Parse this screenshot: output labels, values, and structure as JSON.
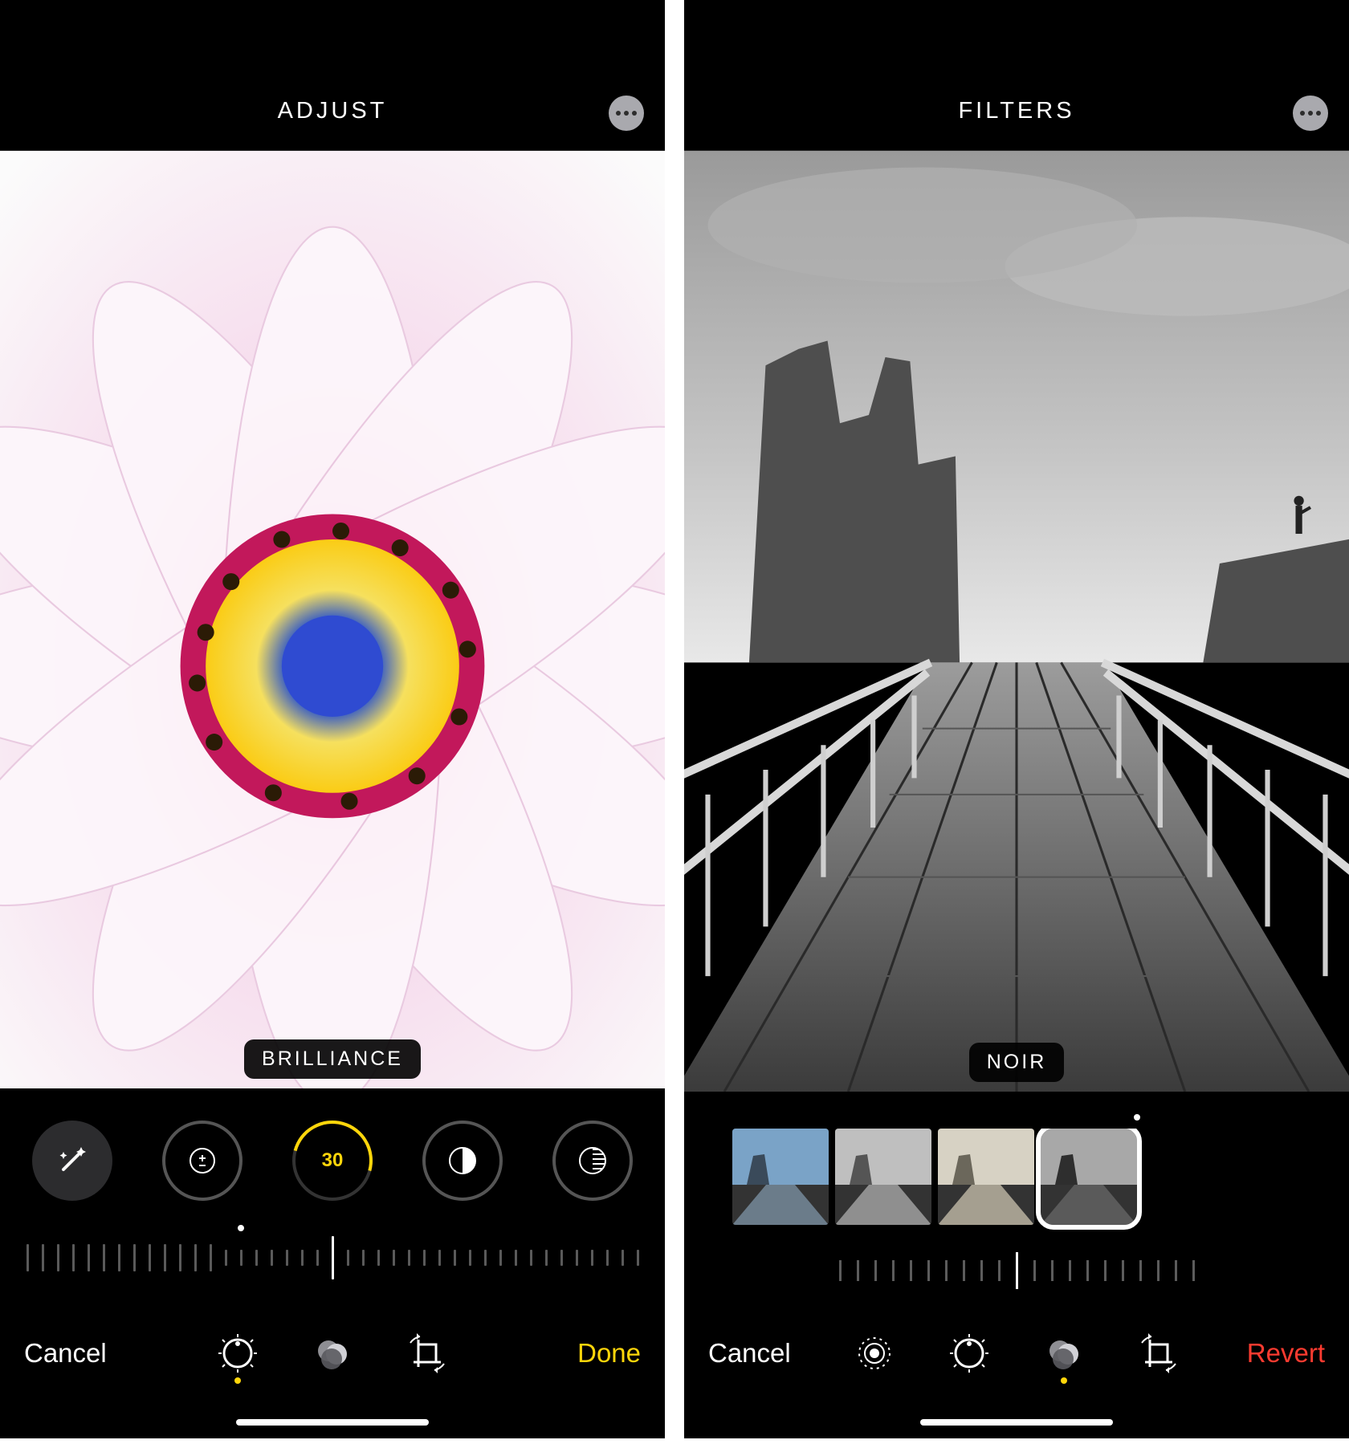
{
  "left": {
    "header": {
      "title": "ADJUST"
    },
    "badge": "BRILLIANCE",
    "adjustment_value": "30",
    "toolbar": {
      "cancel": "Cancel",
      "done": "Done"
    },
    "dials": {
      "wand": "auto-enhance-icon",
      "exposure": "exposure-icon",
      "brilliance_value": "30",
      "highlights": "highlights-icon",
      "shadows": "shadows-icon"
    },
    "bottom_tools": {
      "adjust": "adjust-dial-icon",
      "filters": "filters-circles-icon",
      "crop": "crop-rotate-icon"
    }
  },
  "right": {
    "header": {
      "title": "FILTERS"
    },
    "badge": "NOIR",
    "toolbar": {
      "cancel": "Cancel",
      "revert": "Revert"
    },
    "bottom_tools": {
      "live": "live-photo-icon",
      "adjust": "adjust-dial-icon",
      "filters": "filters-circles-icon",
      "crop": "crop-rotate-icon"
    },
    "filter_thumbs": [
      "dramatic-cool",
      "mono",
      "silvertone",
      "noir"
    ]
  },
  "colors": {
    "accent": "#ffd60a",
    "destructive": "#ff3b30"
  }
}
